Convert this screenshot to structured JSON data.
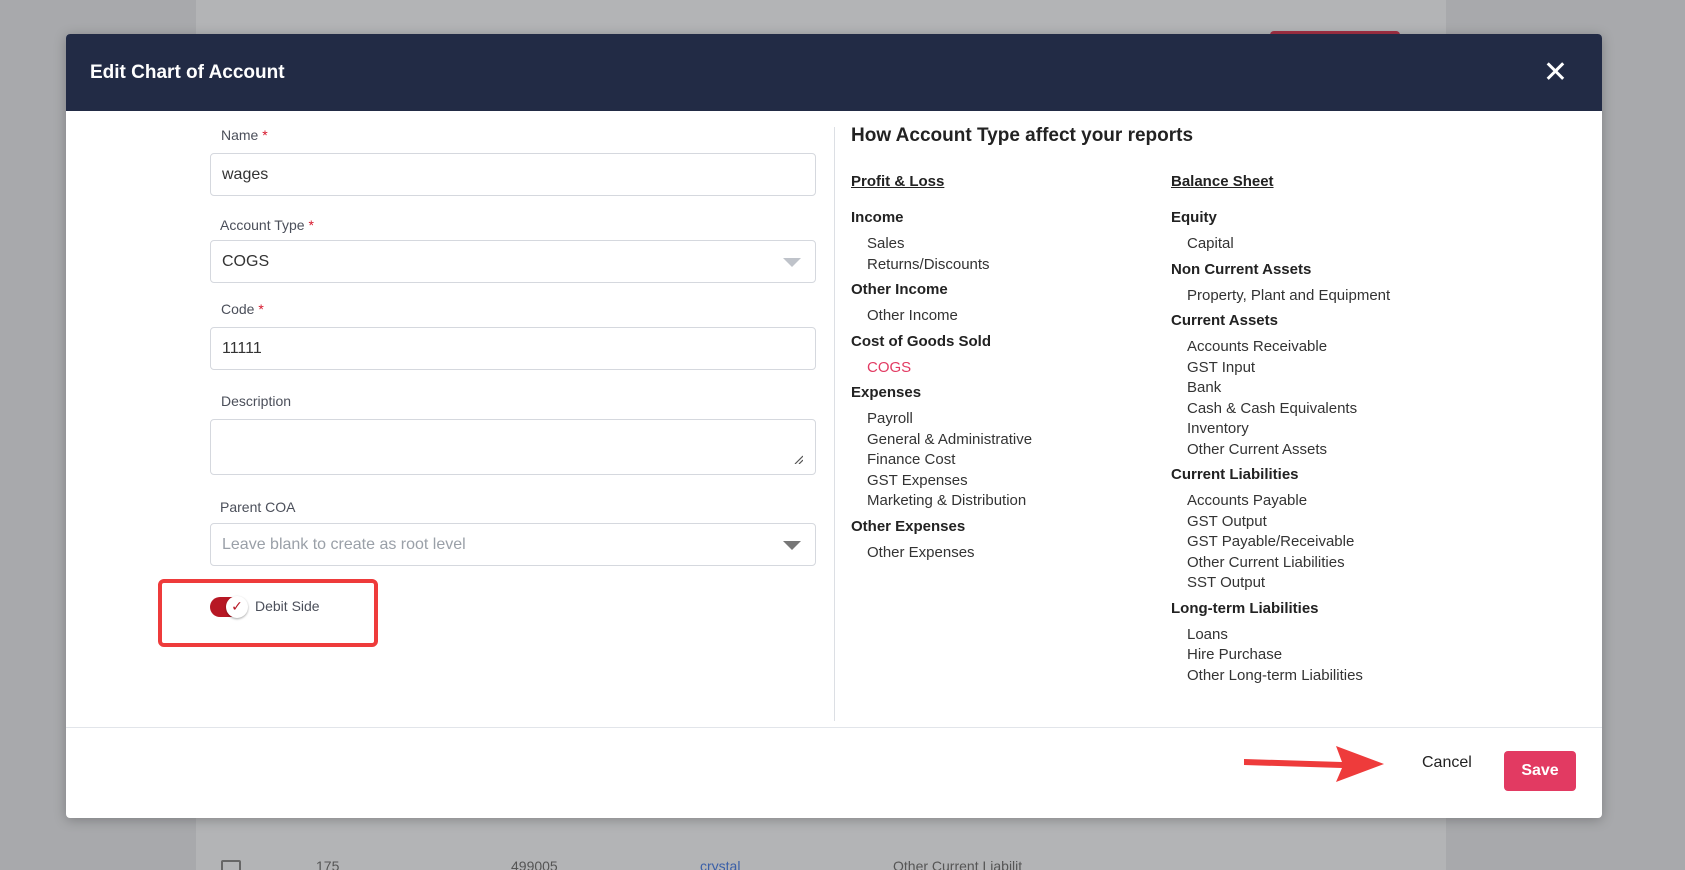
{
  "modal": {
    "title": "Edit Chart of Account",
    "close_icon": "close-icon"
  },
  "form": {
    "name": {
      "label": "Name",
      "required": "*",
      "value": "wages"
    },
    "account_type": {
      "label": "Account Type",
      "required": "*",
      "value": "COGS"
    },
    "code": {
      "label": "Code",
      "required": "*",
      "value": "11111"
    },
    "description": {
      "label": "Description",
      "value": ""
    },
    "parent_coa": {
      "label": "Parent COA",
      "placeholder": "Leave blank to create as root level"
    },
    "debit_side": {
      "label": "Debit Side",
      "checked": true
    }
  },
  "info": {
    "title": "How Account Type affect your reports",
    "profit_loss": {
      "heading": "Profit & Loss",
      "groups": [
        {
          "title": "Income",
          "items": [
            "Sales",
            "Returns/Discounts"
          ]
        },
        {
          "title": "Other Income",
          "items": [
            "Other Income"
          ]
        },
        {
          "title": "Cost of Goods Sold",
          "items": [
            "COGS"
          ]
        },
        {
          "title": "Expenses",
          "items": [
            "Payroll",
            "General & Administrative",
            "Finance Cost",
            "GST Expenses",
            "Marketing & Distribution"
          ]
        },
        {
          "title": "Other Expenses",
          "items": [
            "Other Expenses"
          ]
        }
      ],
      "active_item": "COGS"
    },
    "balance_sheet": {
      "heading": "Balance Sheet",
      "groups": [
        {
          "title": "Equity",
          "items": [
            "Capital"
          ]
        },
        {
          "title": "Non Current Assets",
          "items": [
            "Property, Plant and Equipment"
          ]
        },
        {
          "title": "Current Assets",
          "items": [
            "Accounts Receivable",
            "GST Input",
            "Bank",
            "Cash & Cash Equivalents",
            "Inventory",
            "Other Current Assets"
          ]
        },
        {
          "title": "Current Liabilities",
          "items": [
            "Accounts Payable",
            "GST Output",
            "GST Payable/Receivable",
            "Other Current Liabilities",
            "SST Output"
          ]
        },
        {
          "title": "Long-term Liabilities",
          "items": [
            "Loans",
            "Hire Purchase",
            "Other Long-term Liabilities"
          ]
        }
      ]
    }
  },
  "footer": {
    "cancel_label": "Cancel",
    "save_label": "Save"
  },
  "background": {
    "row": [
      "175",
      "499005",
      "crystal",
      "Other Current Liabilit"
    ]
  },
  "colors": {
    "header_bg": "#222b45",
    "accent": "#e23a62",
    "toggle_on": "#b71724",
    "annotation": "#ee3b3b"
  }
}
